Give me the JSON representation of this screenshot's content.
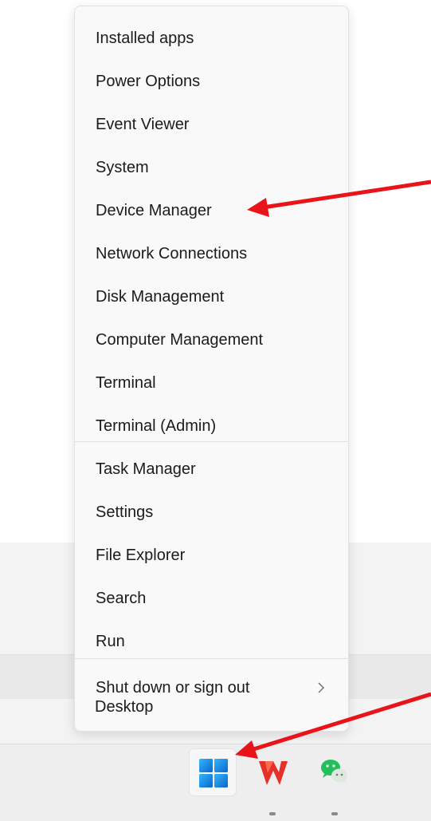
{
  "menu": {
    "items": [
      {
        "label": "Installed apps"
      },
      {
        "label": "Power Options"
      },
      {
        "label": "Event Viewer"
      },
      {
        "label": "System"
      },
      {
        "label": "Device Manager"
      },
      {
        "label": "Network Connections"
      },
      {
        "label": "Disk Management"
      },
      {
        "label": "Computer Management"
      },
      {
        "label": "Terminal"
      },
      {
        "label": "Terminal (Admin)"
      },
      {
        "label": "Task Manager"
      },
      {
        "label": "Settings"
      },
      {
        "label": "File Explorer"
      },
      {
        "label": "Search"
      },
      {
        "label": "Run"
      },
      {
        "label": "Shut down or sign out",
        "submenu_icon": "chevron-right-icon"
      },
      {
        "label": "Desktop"
      }
    ]
  },
  "taskbar": {
    "icons": [
      {
        "name": "windows-start-icon",
        "running": false
      },
      {
        "name": "wps-office-icon",
        "running": true
      },
      {
        "name": "wechat-icon",
        "running": true
      }
    ]
  },
  "annotations": {
    "arrow_color": "#e8141a",
    "arrows": [
      "points-to-device-manager",
      "points-to-start-button"
    ]
  },
  "colors": {
    "menu_bg": "#f9f9f9",
    "text": "#1b1b1b",
    "start_blue": "#0a78d4"
  }
}
